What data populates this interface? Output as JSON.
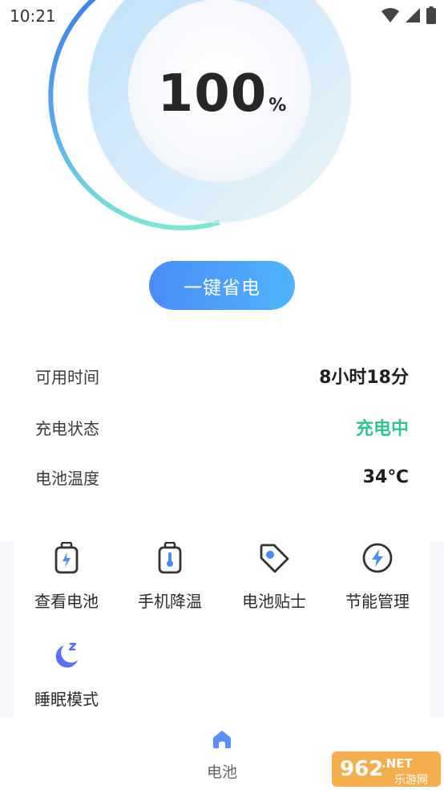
{
  "status_bar": {
    "time": "10:21"
  },
  "battery": {
    "level": 100,
    "unit": "%"
  },
  "actions": {
    "save_power": "一键省电"
  },
  "info": [
    {
      "label": "可用时间",
      "value": "8小时18分"
    },
    {
      "label": "充电状态",
      "value": "充电中"
    },
    {
      "label": "电池温度",
      "value": "34℃"
    }
  ],
  "tools": [
    {
      "label": "查看电池",
      "icon": "battery-bolt-icon"
    },
    {
      "label": "手机降温",
      "icon": "battery-thermometer-icon"
    },
    {
      "label": "电池贴士",
      "icon": "tag-icon"
    },
    {
      "label": "节能管理",
      "icon": "lightning-circle-icon"
    },
    {
      "label": "睡眠模式",
      "icon": "moon-sleep-icon"
    }
  ],
  "nav": {
    "battery_tab": "电池"
  },
  "watermark": {
    "number": "962",
    "suffix": ".NET",
    "site": "乐游网"
  },
  "colors": {
    "accent_blue": "#4a8cf6",
    "charging_green": "#33c48e",
    "text_dark": "#222222"
  }
}
